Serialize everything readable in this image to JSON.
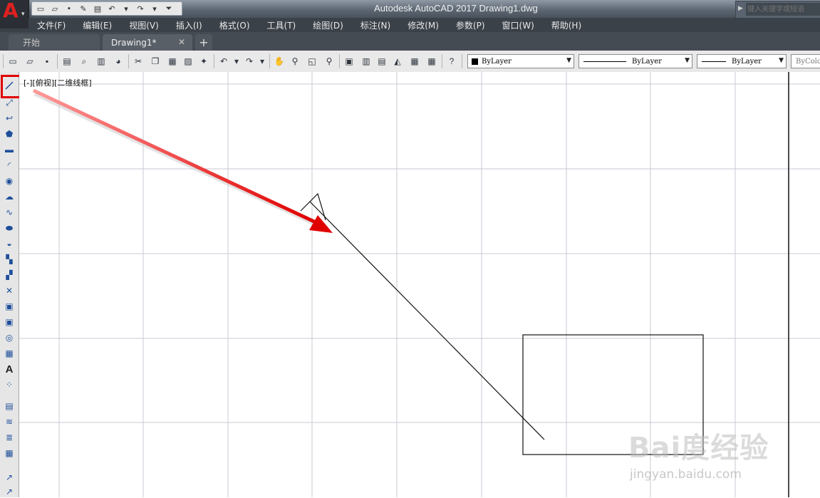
{
  "app": {
    "title": "Autodesk AutoCAD 2017    Drawing1.dwg",
    "logo_letter": "A"
  },
  "search": {
    "placeholder": "键入关键字或短语"
  },
  "menu": [
    {
      "label": "文件(F)"
    },
    {
      "label": "编辑(E)"
    },
    {
      "label": "视图(V)"
    },
    {
      "label": "插入(I)"
    },
    {
      "label": "格式(O)"
    },
    {
      "label": "工具(T)"
    },
    {
      "label": "绘图(D)"
    },
    {
      "label": "标注(N)"
    },
    {
      "label": "修改(M)"
    },
    {
      "label": "参数(P)"
    },
    {
      "label": "窗口(W)"
    },
    {
      "label": "帮助(H)"
    }
  ],
  "tabs": [
    {
      "label": "开始"
    },
    {
      "label": "Drawing1*"
    }
  ],
  "toolbar": {
    "color_value": "ByLayer",
    "linetype_value": "ByLayer",
    "lineweight_value": "ByLayer",
    "plotstyle_value": "ByColor"
  },
  "viewport": {
    "label": "[-][俯视][二维线框]"
  },
  "watermark": {
    "main": "Bai度经验",
    "sub": "jingyan.baidu.com"
  },
  "colors": {
    "highlight": "#e00000",
    "grid": "#c8c8d8",
    "axis": "#000000",
    "menubar": "#3b4148"
  },
  "icons": [
    "line-icon",
    "construction-line-icon",
    "polyline-icon",
    "polygon-icon",
    "rectangle-icon",
    "arc-icon",
    "circle-icon",
    "revision-cloud-icon",
    "spline-icon",
    "ellipse-icon",
    "ellipse-arc-icon",
    "insert-block-icon",
    "make-block-icon",
    "point-icon",
    "hatch-icon",
    "gradient-icon",
    "region-icon",
    "table-icon",
    "multiline-text-icon",
    "add-selected-icon"
  ]
}
